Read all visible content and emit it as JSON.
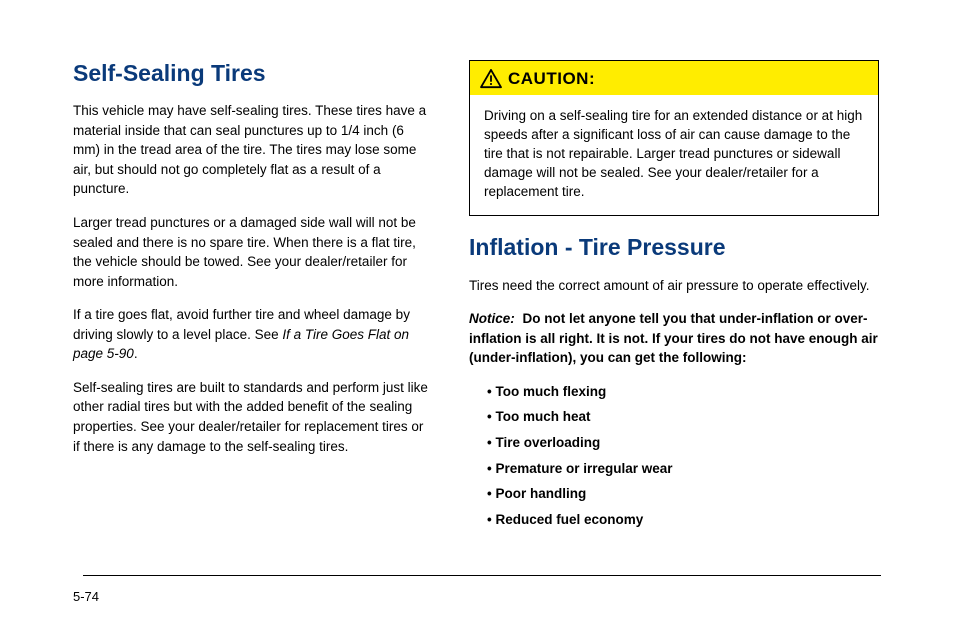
{
  "left": {
    "title": "Self-Sealing Tires",
    "p1": "This vehicle may have self-sealing tires. These tires have a material inside that can seal punctures up to 1/4 inch (6 mm) in the tread area of the tire. The tires may lose some air, but should not go completely flat as a result of a puncture.",
    "p2": "Larger tread punctures or a damaged side wall will not be sealed and there is no spare tire. When there is a flat tire, the vehicle should be towed. See your dealer/retailer for more information.",
    "p3_prefix": "If a tire goes flat, avoid further tire and wheel damage by driving slowly to a level place. See ",
    "p3_em": "If a Tire Goes Flat on page 5-90",
    "p3_suffix": ".",
    "p4": "Self-sealing tires are built to standards and perform just like other radial tires but with the added benefit of the sealing properties. See your dealer/retailer for replacement tires or if there is any damage to the self-sealing tires."
  },
  "caution": {
    "label": "CAUTION:",
    "body": "Driving on a self-sealing tire for an extended distance or at high speeds after a significant loss of air can cause damage to the tire that is not repairable. Larger tread punctures or sidewall damage will not be sealed. See your dealer/retailer for a replacement tire."
  },
  "right": {
    "title": "Inflation - Tire Pressure",
    "p1": "Tires need the correct amount of air pressure to operate effectively.",
    "notice_label": "Notice:",
    "notice_body": "Do not let anyone tell you that under-inflation or over-inflation is all right. It is not. If your tires do not have enough air (under-inflation), you can get the following:",
    "bullets": [
      "Too much flexing",
      "Too much heat",
      "Tire overloading",
      "Premature or irregular wear",
      "Poor handling",
      "Reduced fuel economy"
    ]
  },
  "page_number": "5-74"
}
